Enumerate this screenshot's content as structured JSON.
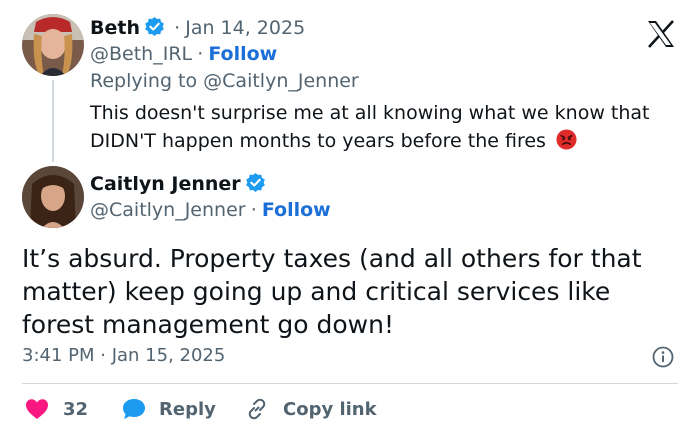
{
  "colors": {
    "accent": "#1d6fd8",
    "like": "#f91880",
    "reply": "#1d9bf0",
    "muted": "#536471",
    "verified": "#1d9bf0"
  },
  "reply_tweet": {
    "name": "Beth",
    "separator": "·",
    "date": "Jan 14, 2025",
    "handle": "@Beth_IRL",
    "follow_sep": "·",
    "follow_label": "Follow",
    "replying_to": "Replying to @Caitlyn_Jenner",
    "text_line1": "This doesn't surprise me at all knowing what we know that",
    "text_line2": "DIDN'T happen months to years before the fires",
    "emoji": "😡"
  },
  "main_tweet": {
    "name": "Caitlyn Jenner",
    "handle": "@Caitlyn_Jenner",
    "follow_sep": "·",
    "follow_label": "Follow",
    "text_line1": "It’s absurd. Property taxes (and all others for that",
    "text_line2": "matter) keep going up and critical services like",
    "text_line3": "forest management go down!",
    "timestamp": "3:41 PM · Jan 15, 2025"
  },
  "actions": {
    "like_count": "32",
    "reply_label": "Reply",
    "copy_link_label": "Copy link"
  },
  "icons": {
    "logo": "x-logo-icon",
    "verified": "verified-badge-icon",
    "info": "info-icon",
    "heart": "heart-icon",
    "reply": "reply-bubble-icon",
    "link": "link-icon"
  }
}
